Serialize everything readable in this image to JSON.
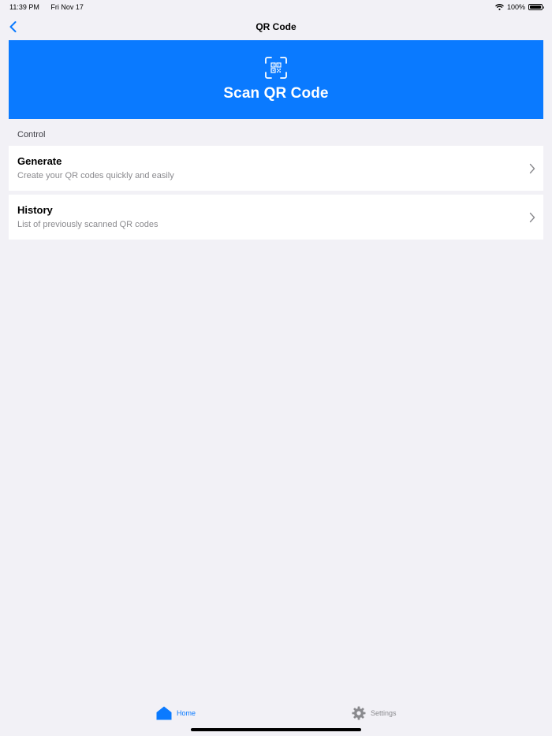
{
  "status_bar": {
    "time": "11:39 PM",
    "date": "Fri Nov 17",
    "battery_text": "100%",
    "icons": [
      "wifi-icon",
      "battery-icon"
    ]
  },
  "nav": {
    "title": "QR Code",
    "back_icon": "chevron-left-icon"
  },
  "scan_banner": {
    "title": "Scan QR Code",
    "icon": "qr-scan-icon",
    "color": "#0a7aff"
  },
  "section": {
    "header": "Control"
  },
  "rows": [
    {
      "title": "Generate",
      "subtitle": "Create your QR codes quickly and easily"
    },
    {
      "title": "History",
      "subtitle": "List of previously scanned QR codes"
    }
  ],
  "tabs": [
    {
      "label": "Home",
      "icon": "home-icon",
      "active": true
    },
    {
      "label": "Settings",
      "icon": "gear-icon",
      "active": false
    }
  ],
  "colors": {
    "accent": "#0a7aff",
    "background": "#f2f1f6",
    "secondary_text": "#8a8a8e"
  }
}
